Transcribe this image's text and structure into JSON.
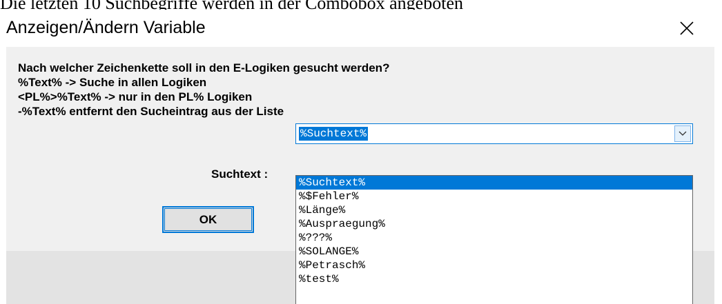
{
  "caption": "Die letzten 10 Suchbegriffe werden in der Combobox angeboten",
  "dialog": {
    "title": "Anzeigen/Ändern Variable",
    "close_glyph": "×",
    "message_lines": [
      "Nach welcher Zeichenkette soll in den E-Logiken gesucht werden?",
      "%Text% -> Suche in allen Logiken",
      "<PL%>%Text% -> nur in den PL% Logiken",
      "-%Text% entfernt den Sucheintrag aus der Liste"
    ],
    "search_label": "Suchtext :",
    "ok_label": "OK",
    "combo": {
      "value": "%Suchtext%",
      "arrow_icon": "chevron-down-icon"
    },
    "dropdown_items": [
      "%Suchtext%",
      "%$Fehler%",
      "%Länge%",
      "%Auspraegung%",
      "%???%",
      "%SOLANGE%",
      "%Petrasch%",
      "%test%"
    ],
    "selected_index": 0
  },
  "colors": {
    "accent": "#0078d7",
    "dialog_background": "#f0f0f0",
    "lower_background": "#e3e3e3"
  }
}
